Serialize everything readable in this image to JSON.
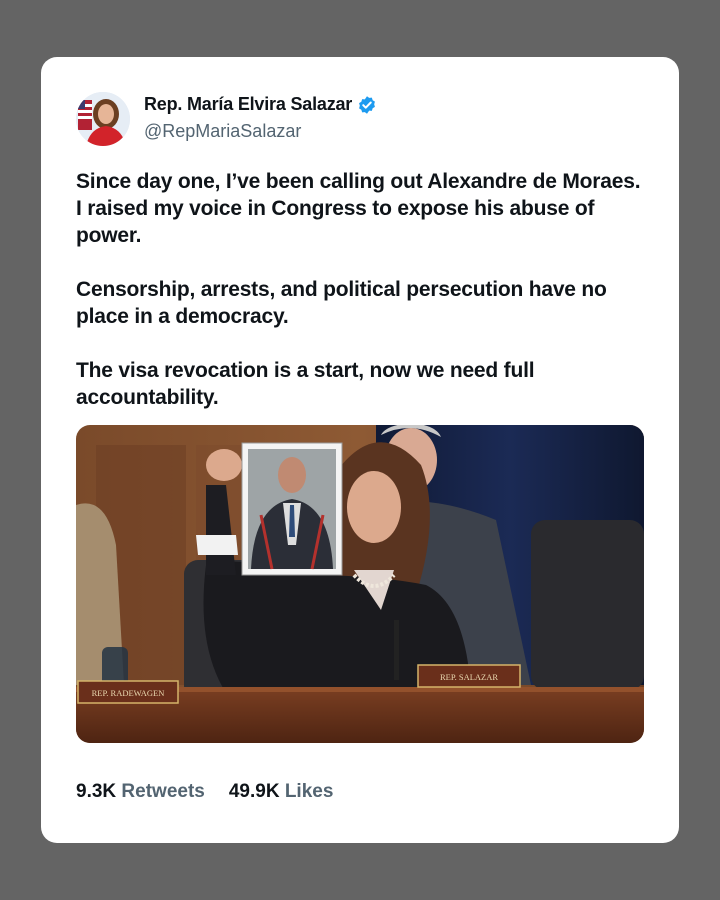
{
  "author": {
    "name": "Rep. María Elvira Salazar",
    "handle": "@RepMariaSalazar",
    "verified": true
  },
  "tweet": {
    "paragraphs": [
      "Since day one, I’ve been calling out Alexandre de Moraes. I raised my voice in Congress to expose his abuse of power.",
      "Censorship, arrests, and political persecution have no place in a democracy.",
      "The visa revocation is a start, now we need full accountability."
    ]
  },
  "media": {
    "nameplate_left": "REP. RADEWAGEN",
    "nameplate_center": "REP. SALAZAR"
  },
  "stats": {
    "retweets_count": "9.3K",
    "retweets_label": "Retweets",
    "likes_count": "49.9K",
    "likes_label": "Likes"
  },
  "colors": {
    "background": "#646464",
    "card": "#ffffff",
    "text": "#0f1419",
    "muted": "#536471",
    "verified": "#1d9bf0"
  }
}
